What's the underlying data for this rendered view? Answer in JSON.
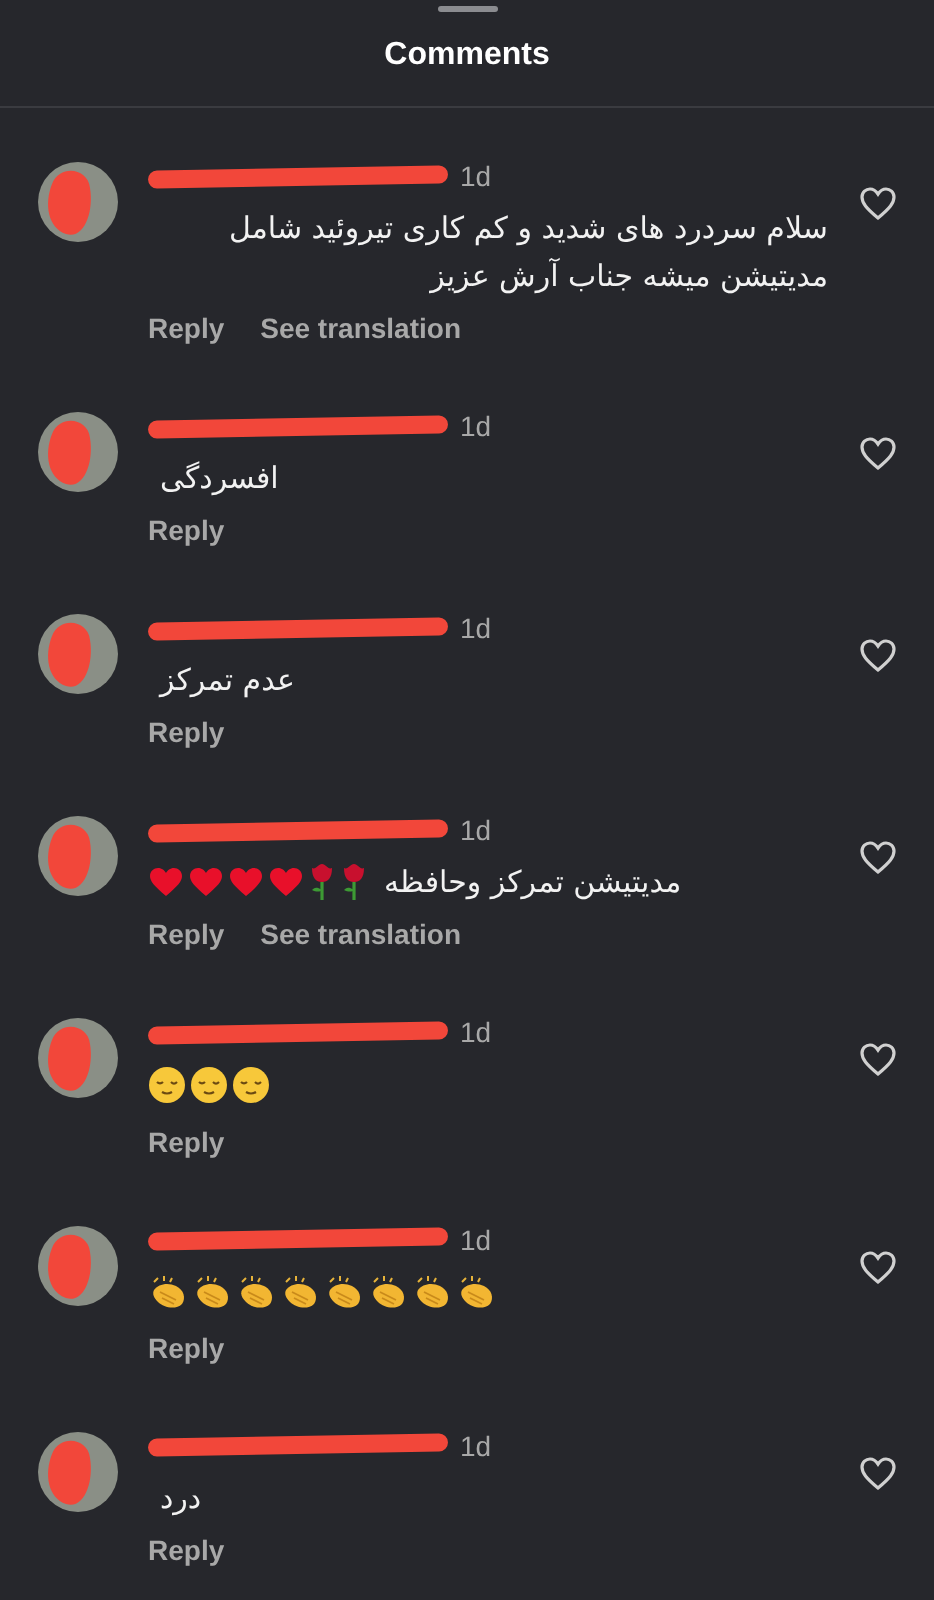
{
  "sheet": {
    "title": "Comments"
  },
  "comments": [
    {
      "time": "1d",
      "text": "سلام سردرد های شدید و کم کاری تیروئید شامل مدیتیشن میشه جناب آرش عزیز",
      "reply": "Reply",
      "translate": "See translation",
      "liked": false
    },
    {
      "time": "1d",
      "text": "افسردگی",
      "reply": "Reply",
      "liked": false
    },
    {
      "time": "1d",
      "text": "عدم تمرکز",
      "reply": "Reply",
      "liked": false
    },
    {
      "time": "1d",
      "text": "مدیتیشن تمرکز وحافظه",
      "emojis": [
        {
          "kind": "rose"
        },
        {
          "kind": "rose"
        },
        {
          "kind": "heart"
        },
        {
          "kind": "heart"
        },
        {
          "kind": "heart"
        },
        {
          "kind": "heart"
        }
      ],
      "reply": "Reply",
      "translate": "See translation",
      "liked": false
    },
    {
      "time": "1d",
      "emojis": [
        {
          "kind": "relieved"
        },
        {
          "kind": "relieved"
        },
        {
          "kind": "relieved"
        }
      ],
      "reply": "Reply",
      "liked": false
    },
    {
      "time": "1d",
      "emojis": [
        {
          "kind": "clap"
        },
        {
          "kind": "clap"
        },
        {
          "kind": "clap"
        },
        {
          "kind": "clap"
        },
        {
          "kind": "clap"
        },
        {
          "kind": "clap"
        },
        {
          "kind": "clap"
        },
        {
          "kind": "clap"
        }
      ],
      "reply": "Reply",
      "liked": false
    },
    {
      "time": "1d",
      "text": "درد",
      "reply": "Reply",
      "liked": false
    }
  ]
}
